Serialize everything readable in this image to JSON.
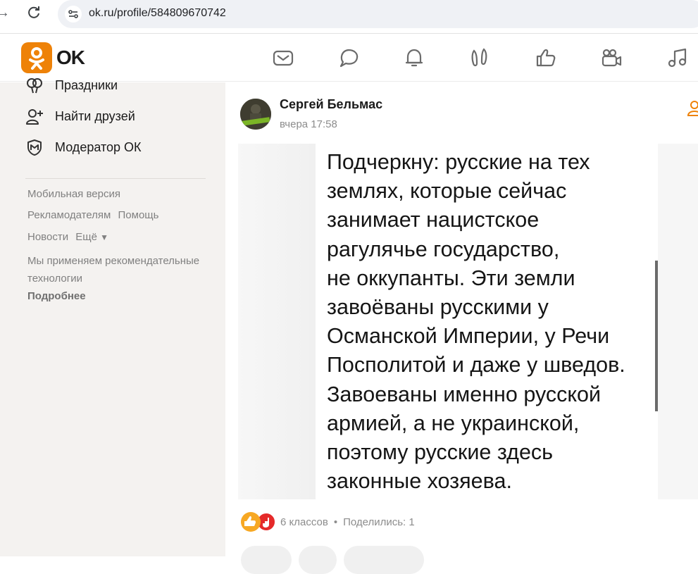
{
  "browser": {
    "url": "ok.ru/profile/584809670742"
  },
  "header": {
    "logo_text": "OK",
    "nav_icons": [
      "mail-icon",
      "chat-icon",
      "bell-icon",
      "guests-icon",
      "like-icon",
      "video-icon",
      "music-icon"
    ]
  },
  "sidebar": {
    "items": [
      {
        "label": "Праздники",
        "icon": "balloons-icon"
      },
      {
        "label": "Найти друзей",
        "icon": "add-friend-icon"
      },
      {
        "label": "Модератор ОК",
        "icon": "moderator-shield-icon"
      }
    ],
    "footer": {
      "mobile": "Мобильная версия",
      "advertisers": "Рекламодателям",
      "help": "Помощь",
      "news": "Новости",
      "more": "Ещё",
      "rec_text": "Мы применяем рекомендательные технологии",
      "details": "Подробнее"
    }
  },
  "post": {
    "author": "Сергей Бельмас",
    "time": "вчера 17:58",
    "image_text": "Подчеркну: русские на тех\nземлях, которые сейчас\nзанимает нацистское\nрагулячье государство,\nне оккупанты. Эти земли\nзавоёваны русскими у\nОсманской Империи, у Речи\nПосполитой и даже у шведов.\nЗавоеваны именно русской\nармией, а не украинской,\nпоэтому русские здесь\nзаконные хозяева.",
    "likes": "6 классов",
    "shares": "Поделились: 1"
  },
  "colors": {
    "brand": "#ee8208",
    "sidebar_bg": "#f4f2f0"
  }
}
